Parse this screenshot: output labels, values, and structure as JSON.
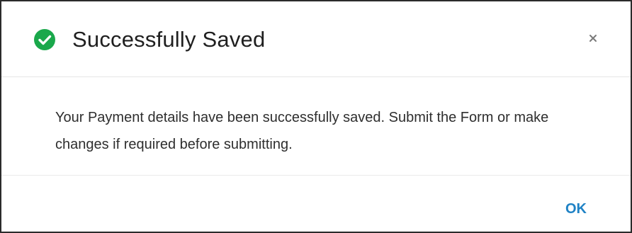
{
  "dialog": {
    "title": "Successfully Saved",
    "title_icon": "check-circle-icon",
    "close_icon": "close-icon",
    "message": "Your Payment details have been successfully saved. Submit the Form or make changes if required before submitting.",
    "ok_label": "OK"
  },
  "colors": {
    "success_green": "#1aa84b",
    "ok_blue": "#1f82c5",
    "border": "#2b2b2b"
  }
}
